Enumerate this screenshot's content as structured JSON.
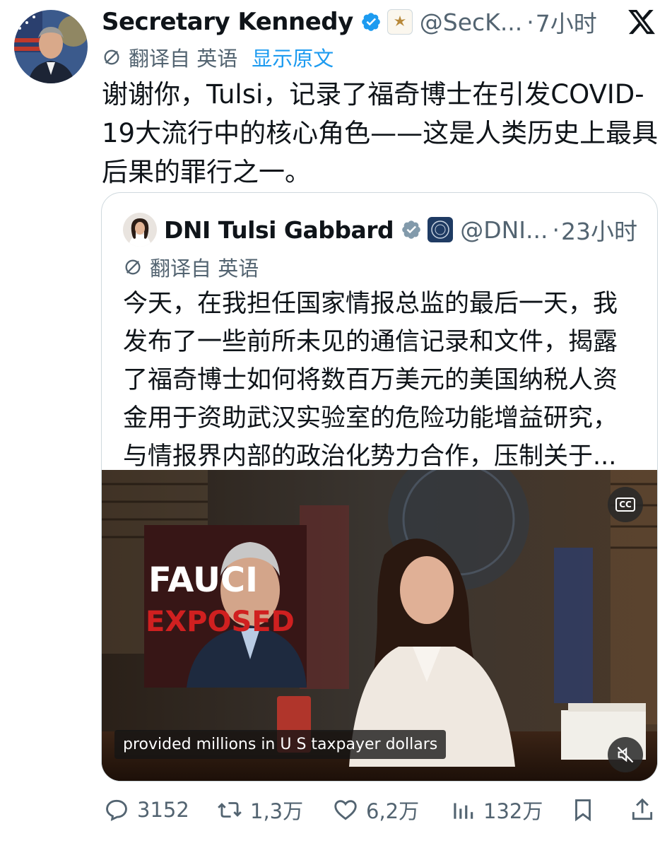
{
  "post": {
    "display_name": "Secretary Kennedy",
    "handle": "@SecK...",
    "time": "7小时",
    "translated_from": "翻译自 英语",
    "show_original": "显示原文",
    "text": "谢谢你，Tulsi，记录了福奇博士在引发COVID-19大流行中的核心角色——这是人类历史上最具后果的罪行之一。"
  },
  "quote": {
    "display_name": "DNI Tulsi Gabbard",
    "handle": "@DNI...",
    "time": "23小时",
    "translated_from": "翻译自 英语",
    "text": "今天，在我担任国家情报总监的最后一天，我发布了一些前所未见的通信记录和文件，揭露了福奇博士如何将数百万美元的美国纳税人资金用于资助武汉实验室的危险功能增益研究，与情报界内部的政治化势力合作，压制关于...",
    "video": {
      "inset_line1": "FAUCI",
      "inset_line2": "EXPOSED",
      "caption": "provided millions in U S taxpayer dollars",
      "cc_label": "CC"
    }
  },
  "separator_dot": "·",
  "actions": {
    "replies": "3152",
    "reposts": "1,3万",
    "likes": "6,2万",
    "views": "132万"
  },
  "colors": {
    "text": "#0f1419",
    "secondary": "#536471",
    "link": "#1d9bf0",
    "verified_blue": "#1d9bf0",
    "border": "#cfd9de"
  },
  "icons": [
    "verified-badge-icon",
    "close-x-icon",
    "translate-icon",
    "cc-icon",
    "mute-icon",
    "reply-icon",
    "repost-icon",
    "like-icon",
    "views-icon",
    "bookmark-icon",
    "share-icon"
  ]
}
